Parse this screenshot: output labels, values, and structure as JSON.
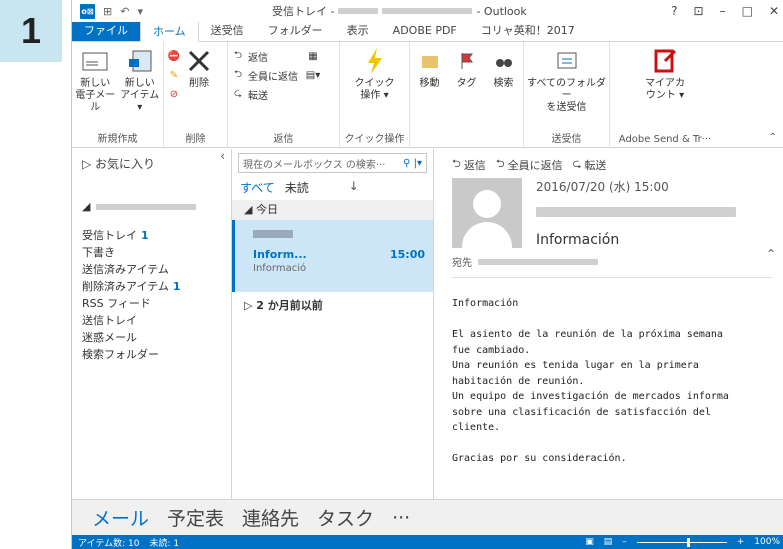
{
  "step": "1",
  "titlebar": {
    "title_prefix": "受信トレイ -",
    "title_suffix": "- Outlook",
    "controls": [
      "?",
      "⊡",
      "–",
      "□",
      "✕"
    ]
  },
  "tabs": [
    {
      "label": "ファイル",
      "kind": "file"
    },
    {
      "label": "ホーム",
      "kind": "active"
    },
    {
      "label": "送受信",
      "kind": ""
    },
    {
      "label": "フォルダー",
      "kind": ""
    },
    {
      "label": "表示",
      "kind": ""
    },
    {
      "label": "ADOBE PDF",
      "kind": ""
    },
    {
      "label": "コリャ英和！2017",
      "kind": ""
    }
  ],
  "ribbon": {
    "new": {
      "new_mail": "新しい\n電子メール",
      "new_items": "新しい\nアイテム ▾",
      "label": "新規作成"
    },
    "delete": {
      "delete": "削除",
      "label": "削除"
    },
    "respond": {
      "reply": "返信",
      "reply_all": "全員に返信",
      "forward": "転送",
      "label": "返信"
    },
    "quick": {
      "quick_steps": "クイック\n操作 ▾",
      "label": "クイック操作"
    },
    "move": {
      "move": "移動",
      "tags": "タグ",
      "find": "検索",
      "label": ""
    },
    "sendrecv": {
      "send_all": "すべてのフォルダー\nを送受信",
      "label": "送受信"
    },
    "adobe": {
      "my_account": "マイアカ\nウント ▾",
      "label": "Adobe Send & Tr···"
    }
  },
  "folders": {
    "favorites": "▷ お気に入り",
    "items": [
      {
        "name": "受信トレイ",
        "count": "1"
      },
      {
        "name": "下書き",
        "count": ""
      },
      {
        "name": "送信済みアイテム",
        "count": ""
      },
      {
        "name": "削除済みアイテム",
        "count": "1"
      },
      {
        "name": "RSS フィード",
        "count": ""
      },
      {
        "name": "送信トレイ",
        "count": ""
      },
      {
        "name": "迷惑メール",
        "count": ""
      },
      {
        "name": "検索フォルダー",
        "count": ""
      }
    ]
  },
  "list": {
    "search_placeholder": "現在のメールボックス の検索···",
    "filter_all": "すべて",
    "filter_unread": "未読",
    "sort_icon": "↓",
    "group_today": "◢ 今日",
    "mail": {
      "subject": "Inform...",
      "time": "15:00",
      "preview": "Informació"
    },
    "group_older": "▷ 2 か月前以前"
  },
  "reading": {
    "reply": "返信",
    "reply_all": "全員に返信",
    "forward": "転送",
    "date": "2016/07/20 (水) 15:00",
    "subject": "Información",
    "to_label": "宛先",
    "body": "Información\n\nEl asiento de la reunión de la próxima semana\nfue cambiado.\nUna reunión es tenida lugar en la primera\nhabitación de reunión.\nUn equipo de investigación de mercados informa\nsobre una clasificación de satisfacción del\ncliente.\n\nGracias por su consideración."
  },
  "navbar": [
    "メール",
    "予定表",
    "連絡先",
    "タスク",
    "···"
  ],
  "status": {
    "items": "アイテム数: 10",
    "unread": "未読: 1",
    "zoom": "100%"
  }
}
